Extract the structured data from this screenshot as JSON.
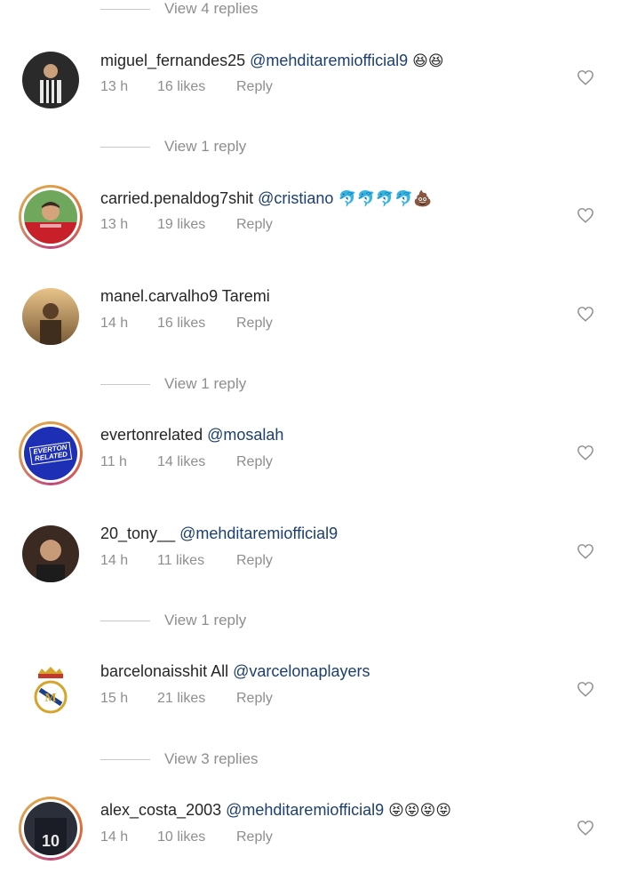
{
  "view_replies": [
    "View 4 replies",
    "View 1 reply",
    "View 1 reply",
    "View 1 reply",
    "View 3 replies"
  ],
  "comments": [
    {
      "username": "miguel_fernandes25",
      "mention": "@mehditaremiofficial9",
      "text": "",
      "emoji": "😆😆",
      "time": "13 h",
      "likes": "16 likes",
      "reply": "Reply"
    },
    {
      "username": "carried.penaldog7shit",
      "mention": "@cristiano",
      "text": "",
      "emoji": "🐬🐬🐬🐬💩",
      "time": "13 h",
      "likes": "19 likes",
      "reply": "Reply"
    },
    {
      "username": "manel.carvalho9",
      "mention": "",
      "text": "Taremi",
      "emoji": "",
      "time": "14 h",
      "likes": "16 likes",
      "reply": "Reply"
    },
    {
      "username": "evertonrelated",
      "mention": "@mosalah",
      "text": "",
      "emoji": "",
      "time": "11 h",
      "likes": "14 likes",
      "reply": "Reply",
      "avatar_text": "EVERTON RELATED"
    },
    {
      "username": "20_tony__",
      "mention": "@mehditaremiofficial9",
      "text": "",
      "emoji": "",
      "time": "14 h",
      "likes": "11 likes",
      "reply": "Reply"
    },
    {
      "username": "barcelonaisshit",
      "mention": "@varcelonaplayers",
      "text": "All",
      "emoji": "",
      "time": "15 h",
      "likes": "21 likes",
      "reply": "Reply"
    },
    {
      "username": "alex_costa_2003",
      "mention": "@mehditaremiofficial9",
      "text": "",
      "emoji": "😝😝😝😝",
      "time": "14 h",
      "likes": "10 likes",
      "reply": "Reply"
    }
  ],
  "icons": {
    "like": "heart-outline-icon"
  },
  "colors": {
    "mention": "#1d3f6e",
    "meta": "#8e8e8e",
    "story_ring": "#e06b3a"
  }
}
